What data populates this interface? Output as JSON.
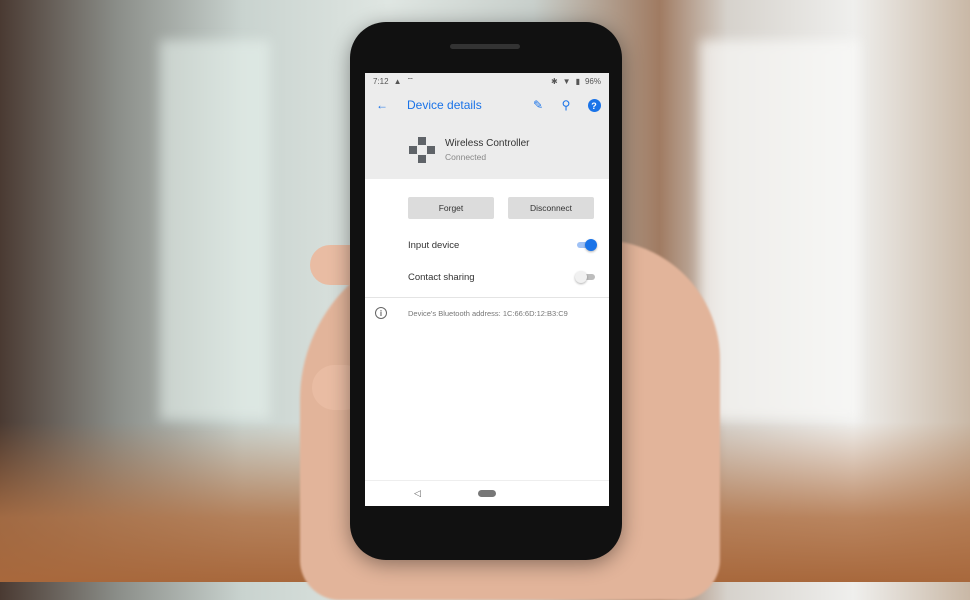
{
  "status_bar": {
    "time": "7:12",
    "left_icons": [
      "warning-icon",
      "wifi-hotspot-icon"
    ],
    "right_icons": [
      "bluetooth-icon",
      "wifi-icon",
      "battery-icon"
    ],
    "battery": "96%"
  },
  "app_bar": {
    "title": "Device details",
    "back_icon": "←",
    "edit_icon": "✎",
    "search_icon": "⚲",
    "help_icon": "?"
  },
  "device": {
    "name": "Wireless Controller",
    "status": "Connected",
    "icon": "gamepad-icon"
  },
  "buttons": {
    "forget": "Forget",
    "disconnect": "Disconnect"
  },
  "settings": [
    {
      "label": "Input device",
      "enabled": true
    },
    {
      "label": "Contact sharing",
      "enabled": false
    }
  ],
  "info": {
    "icon": "i",
    "text": "Device's Bluetooth address: 1C:66:6D:12:B3:C9"
  },
  "nav_bar": {
    "back": "◁"
  },
  "colors": {
    "accent": "#1a73e8",
    "header_bg": "#ececec",
    "switch_off_track": "#bdbdbd",
    "switch_off_thumb": "#f1f1f1"
  }
}
